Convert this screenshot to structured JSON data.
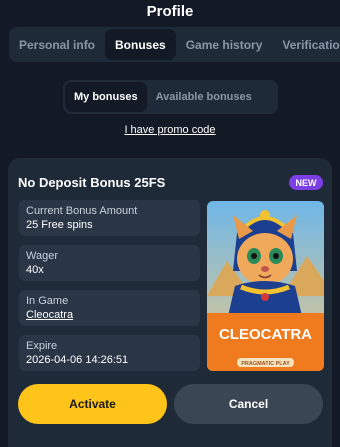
{
  "header": {
    "title": "Profile"
  },
  "tabs": [
    {
      "label": "Personal info"
    },
    {
      "label": "Bonuses"
    },
    {
      "label": "Game history"
    },
    {
      "label": "Verification"
    }
  ],
  "subtabs": [
    {
      "label": "My bonuses"
    },
    {
      "label": "Available bonuses"
    }
  ],
  "promo_link": "I have promo code",
  "bonus": {
    "title": "No Deposit Bonus 25FS",
    "badge": "NEW",
    "fields": [
      {
        "label": "Current Bonus Amount",
        "value": "25 Free spins"
      },
      {
        "label": "Wager",
        "value": "40x"
      },
      {
        "label": "In Game",
        "value": "Cleocatra"
      },
      {
        "label": "Expire",
        "value": "2026-04-06 14:26:51"
      }
    ],
    "game_image_text": "CLEOCATRA",
    "game_image_subtext": "PRAGMATIC PLAY",
    "activate_label": "Activate",
    "cancel_label": "Cancel"
  },
  "colors": {
    "background": "#131a26",
    "panel": "#1f2a38",
    "accent_yellow": "#ffc41a",
    "badge_purple": "#7b3fe4"
  }
}
